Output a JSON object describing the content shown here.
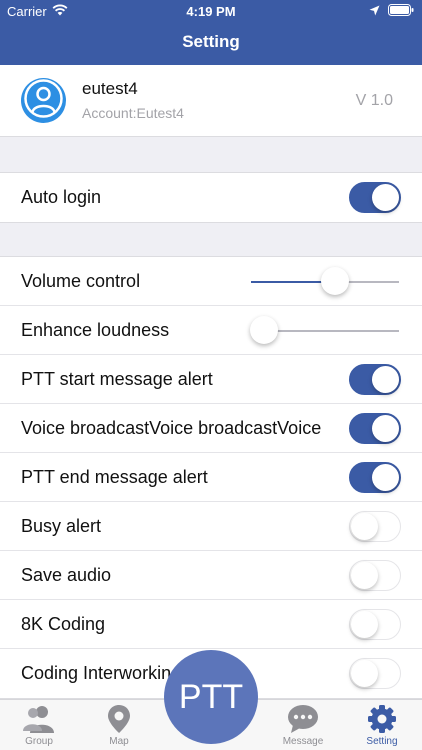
{
  "status_bar": {
    "carrier": "Carrier",
    "time": "4:19 PM"
  },
  "nav": {
    "title": "Setting"
  },
  "profile": {
    "name": "eutest4",
    "account": "Account:Eutest4",
    "version": "V 1.0"
  },
  "settings": {
    "auto_login": {
      "label": "Auto login",
      "on": true
    },
    "volume_control": {
      "label": "Volume control",
      "value": 0.57
    },
    "enhance_loudness": {
      "label": "Enhance loudness",
      "value": 0.09
    },
    "ptt_start_alert": {
      "label": "PTT start message alert",
      "on": true
    },
    "voice_broadcast": {
      "label": "Voice broadcastVoice broadcastVoice",
      "on": true
    },
    "ptt_end_alert": {
      "label": "PTT end message alert",
      "on": true
    },
    "busy_alert": {
      "label": "Busy alert",
      "on": false
    },
    "save_audio": {
      "label": "Save audio",
      "on": false
    },
    "coding_8k": {
      "label": "8K Coding",
      "on": false
    },
    "coding_interworking": {
      "label": "Coding Interworking",
      "on": false
    }
  },
  "ptt_button": {
    "label": "PTT"
  },
  "tabs": [
    {
      "label": "Group",
      "icon": "group-icon",
      "active": false
    },
    {
      "label": "Map",
      "icon": "map-pin-icon",
      "active": false
    },
    {
      "label": "Message",
      "icon": "message-icon",
      "active": false
    },
    {
      "label": "Setting",
      "icon": "gear-icon",
      "active": true
    }
  ],
  "colors": {
    "accent": "#3b5ba5",
    "avatar": "#2d8fe3",
    "ptt": "#5c75ba"
  }
}
